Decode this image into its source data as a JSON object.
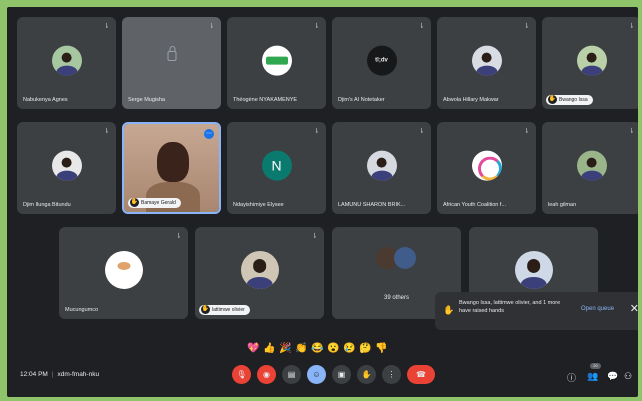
{
  "participants": [
    {
      "name": "Nabukenya Agnes"
    },
    {
      "name": "Serge Mugisha"
    },
    {
      "name": "Théogène NYAKAMENYE"
    },
    {
      "name": "Djim's AI Notetaker",
      "logo_text": "tl;dv"
    },
    {
      "name": "Abwola Hillary Makwar"
    },
    {
      "name": "Bwango Issa"
    },
    {
      "name": "Djim Ilunga Bitundu"
    },
    {
      "name": "Bamaye Gerald"
    },
    {
      "name": "Ndayishimiye Elysee",
      "initial": "N"
    },
    {
      "name": "LAMUNU SHARON BRIK..."
    },
    {
      "name": "African Youth Coalition f..."
    },
    {
      "name": "leah gilman"
    },
    {
      "name": "Mucungumco"
    },
    {
      "name": "lattimwe olivier"
    }
  ],
  "others": {
    "label": "39 others"
  },
  "raised_hands": {
    "text": "Bwango Issa, lattimwe olivier, and 1 more have raised hands",
    "open_queue": "Open queue"
  },
  "meeting": {
    "time": "12:04 PM",
    "code": "xdm-fmah-nku"
  },
  "reactions": [
    "💖",
    "👍",
    "🎉",
    "👏",
    "😂",
    "😮",
    "😢",
    "🤔",
    "👎"
  ],
  "icons": {
    "mic": "microphone-icon",
    "hand": "raised-hand-icon",
    "lock": "lock-icon"
  },
  "colors": {
    "background": "#1f2023",
    "tile": "#3c4043",
    "accent": "#8ab4f8",
    "danger": "#ea4335"
  },
  "right_badge": "20"
}
